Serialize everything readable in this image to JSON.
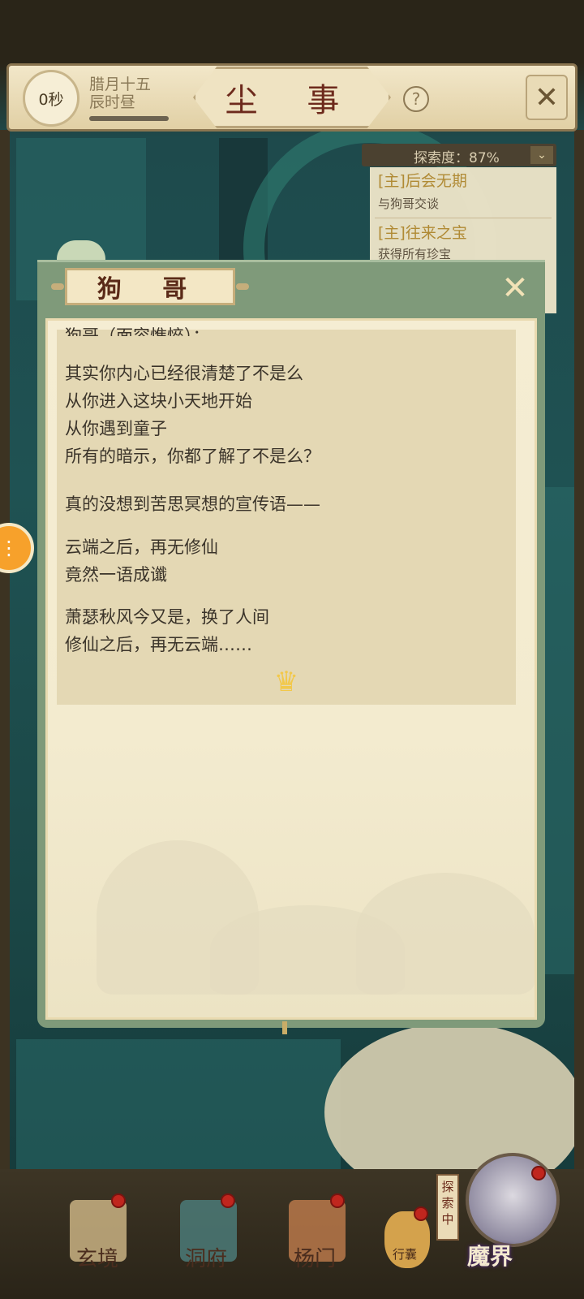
{
  "top_bar": {
    "timer": "0秒",
    "date_line1": "腊月十五",
    "date_line2": "辰时昼",
    "title": "尘 事",
    "help_icon_glyph": "?",
    "close_icon_glyph": "✕"
  },
  "explore_panel": {
    "progress_label": "探索度：87%",
    "toggle_glyph": "⌄",
    "quests": [
      {
        "title": "[主]后会无期",
        "desc": "与狗哥交谈"
      },
      {
        "title": "[主]往来之宝",
        "desc": "获得所有珍宝"
      }
    ]
  },
  "side_button": {
    "glyph": "⋮"
  },
  "dialog": {
    "name": "狗 哥",
    "close_glyph": "✕",
    "speaker_line": "狗哥（面容憔悴）：",
    "lines": [
      "其实你内心已经很清楚了不是么",
      "从你进入这块小天地开始",
      "从你遇到童子",
      "所有的暗示，你都了解了不是么？",
      "真的没想到苦思冥想的宣传语——",
      "云端之后，再无修仙",
      "竟然一语成谶",
      "萧瑟秋风今又是，换了人间",
      "修仙之后，再无云端……"
    ],
    "more_glyph": "♛"
  },
  "bottom_nav": {
    "items": [
      {
        "label": "玄境"
      },
      {
        "label": "洞府"
      },
      {
        "label": "杨门"
      },
      {
        "label": "行囊"
      }
    ],
    "explore_tag": "探索中",
    "current_realm": "魔界"
  },
  "colors": {
    "accent_red": "#c0261e",
    "dialog_green": "#7f9a7a",
    "quest_gold": "#b08a34"
  }
}
